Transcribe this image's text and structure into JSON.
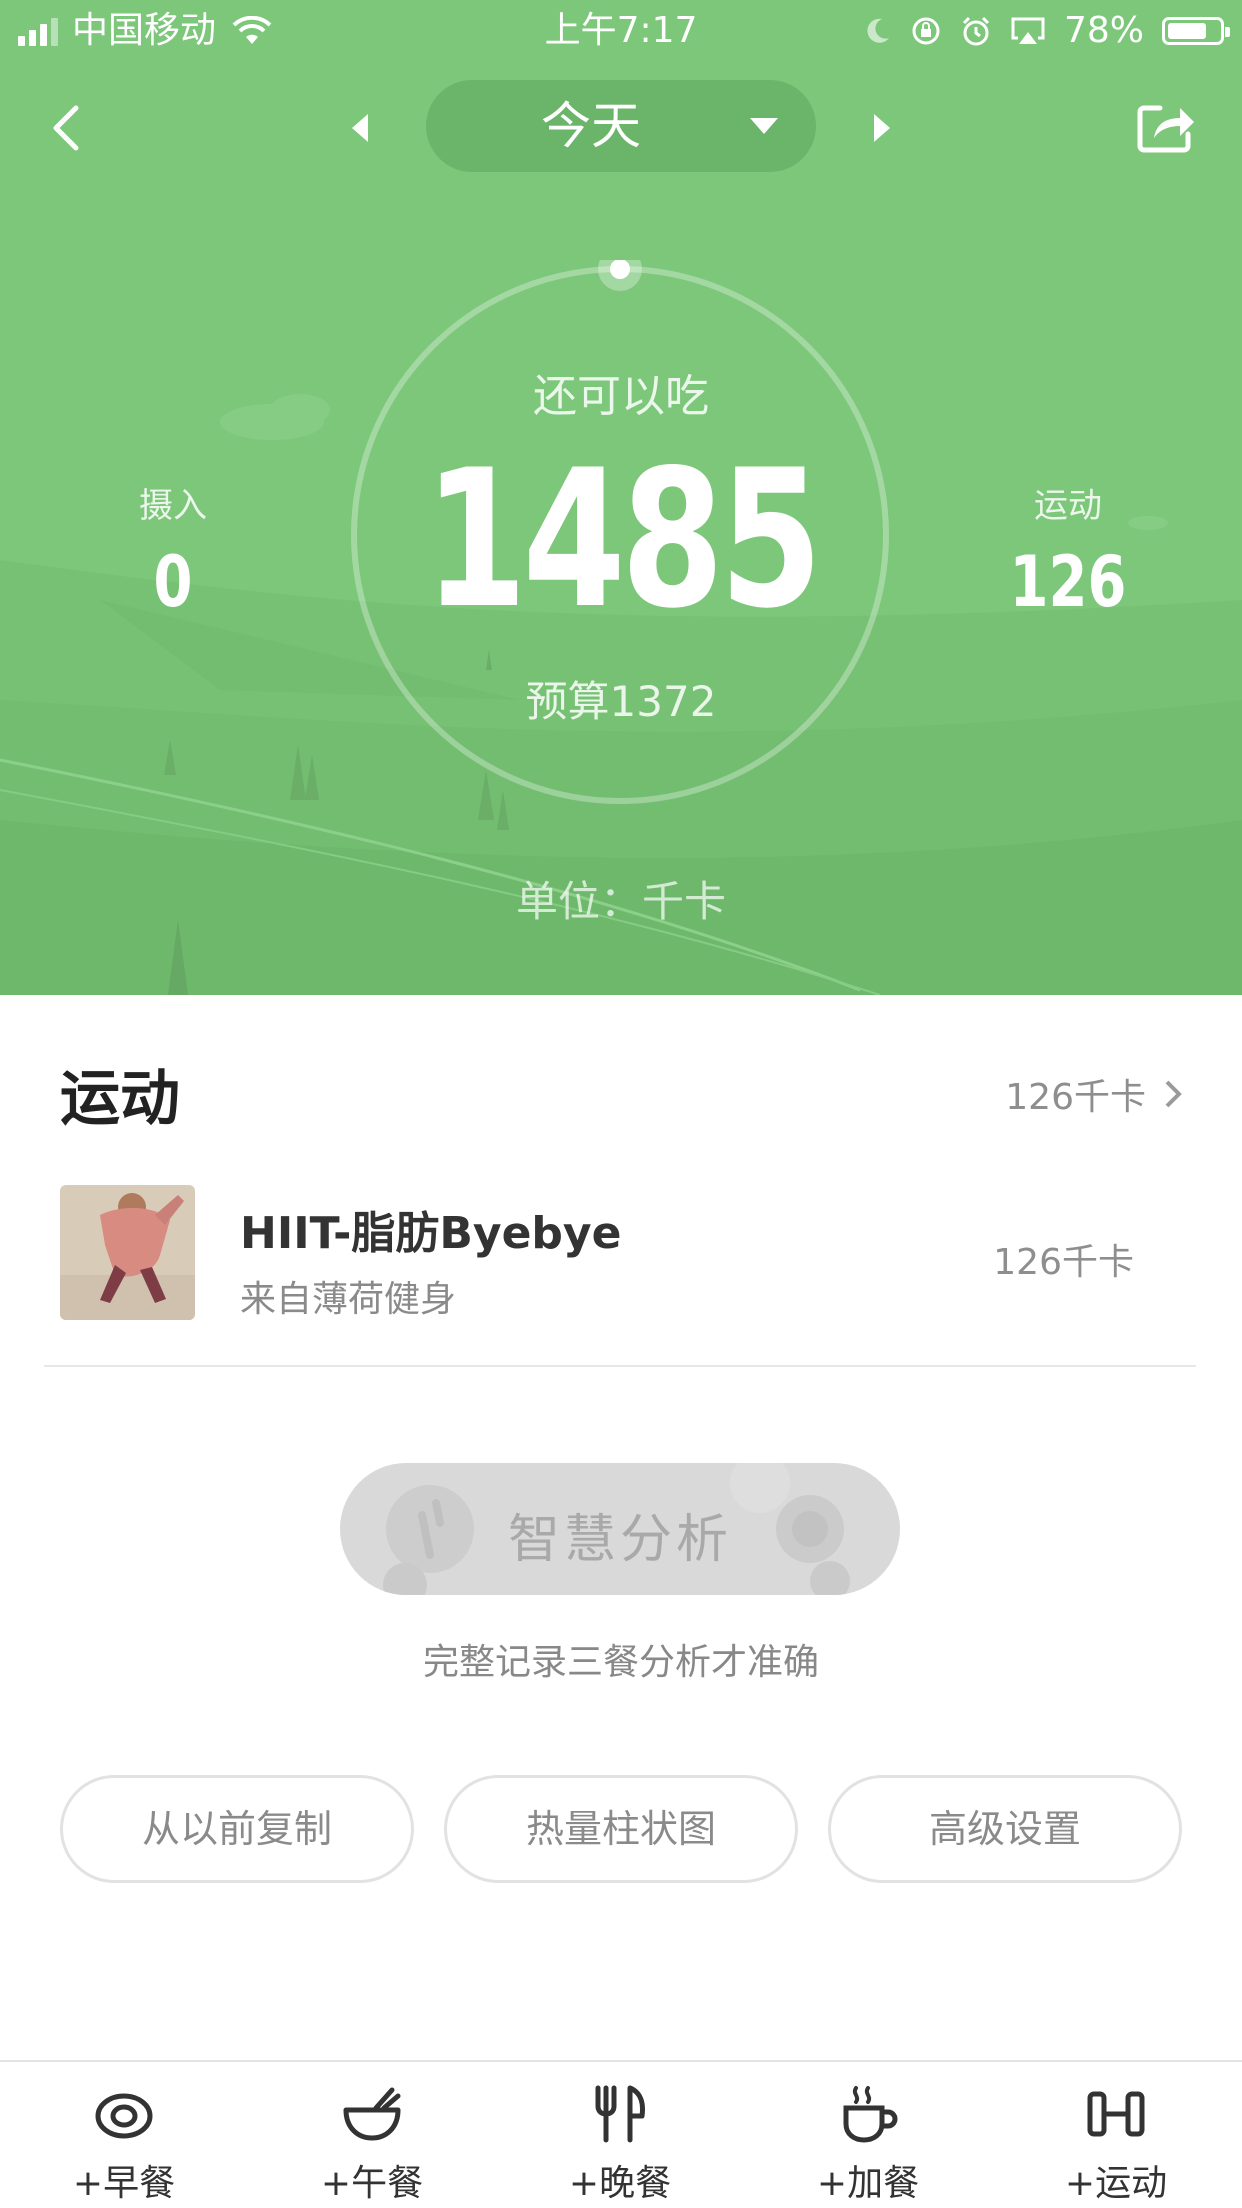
{
  "status_bar": {
    "carrier": "中国移动",
    "time": "上午7:17",
    "battery": "78%",
    "battery_level": 0.78
  },
  "nav": {
    "date_label": "今天"
  },
  "summary": {
    "remain_label": "还可以吃",
    "remain_value": "1485",
    "budget": "预算1372",
    "intake_label": "摄入",
    "intake_value": "0",
    "exercise_label": "运动",
    "exercise_value": "126",
    "unit": "单位：千卡"
  },
  "exercise_section": {
    "title": "运动",
    "total": "126千卡",
    "items": [
      {
        "name": "HIIT-脂肪Byebye",
        "source": "来自薄荷健身",
        "kcal": "126千卡"
      }
    ]
  },
  "analysis": {
    "button_label": "智慧分析",
    "hint": "完整记录三餐分析才准确"
  },
  "actions": [
    {
      "label": "从以前复制"
    },
    {
      "label": "热量柱状图"
    },
    {
      "label": "高级设置"
    }
  ],
  "tabs": [
    {
      "label": "+早餐",
      "icon": "egg-icon"
    },
    {
      "label": "+午餐",
      "icon": "bowl-icon"
    },
    {
      "label": "+晚餐",
      "icon": "fork-knife-icon"
    },
    {
      "label": "+加餐",
      "icon": "cup-icon"
    },
    {
      "label": "+运动",
      "icon": "dumbbell-icon"
    }
  ],
  "colors": {
    "hero_green": "#7dc77b",
    "pill_green": "#6bb56a",
    "text_dark": "#222222",
    "text_gray": "#8e8e8e"
  }
}
